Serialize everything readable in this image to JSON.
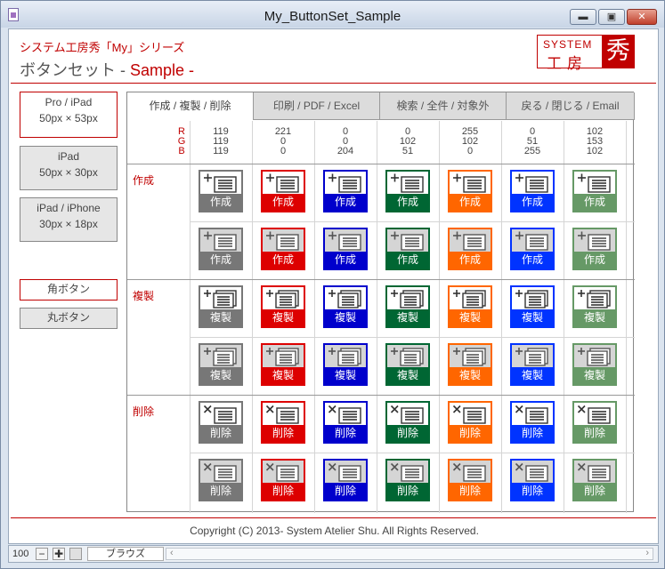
{
  "window": {
    "title": "My_ButtonSet_Sample",
    "min_glyph": "▬",
    "max_glyph": "▣",
    "close_glyph": "✕"
  },
  "header": {
    "subtitle": "システム工房秀「My」シリーズ",
    "heading_main": "ボタンセット - ",
    "heading_accent": "Sample -",
    "logo_top": "SYSTEM",
    "logo_bottom": "工房",
    "logo_mark": "秀"
  },
  "sidebar": {
    "sizes": [
      {
        "name": "Pro / iPad",
        "size": "50px × 53px",
        "selected": true
      },
      {
        "name": "iPad",
        "size": "50px × 30px",
        "selected": false
      },
      {
        "name": "iPad / iPhone",
        "size": "30px × 18px",
        "selected": false
      }
    ],
    "shapes": [
      {
        "label": "角ボタン",
        "selected": true
      },
      {
        "label": "丸ボタン",
        "selected": false
      }
    ]
  },
  "tabs": [
    {
      "label": "作成 / 複製 / 削除",
      "active": true
    },
    {
      "label": "印刷 / PDF / Excel",
      "active": false
    },
    {
      "label": "検索 / 全件 / 対象外",
      "active": false
    },
    {
      "label": "戻る / 閉じる / Email",
      "active": false
    }
  ],
  "rgb_labels": [
    "R",
    "G",
    "B"
  ],
  "colors": [
    {
      "r": "119",
      "g": "119",
      "b": "119",
      "hex": "#777777"
    },
    {
      "r": "221",
      "g": "0",
      "b": "0",
      "hex": "#dd0000"
    },
    {
      "r": "0",
      "g": "0",
      "b": "204",
      "hex": "#0000cc"
    },
    {
      "r": "0",
      "g": "102",
      "b": "51",
      "hex": "#006633"
    },
    {
      "r": "255",
      "g": "102",
      "b": "0",
      "hex": "#ff6600"
    },
    {
      "r": "0",
      "g": "51",
      "b": "255",
      "hex": "#0033ff"
    },
    {
      "r": "102",
      "g": "153",
      "b": "102",
      "hex": "#669966"
    }
  ],
  "rows": [
    {
      "label": "作成",
      "button_text": "作成",
      "icon": "create-icon"
    },
    {
      "label": "複製",
      "button_text": "複製",
      "icon": "copy-icon"
    },
    {
      "label": "削除",
      "button_text": "削除",
      "icon": "delete-icon"
    }
  ],
  "footer": {
    "copyright": "Copyright (C) 2013- System Atelier Shu. All Rights Reserved."
  },
  "statusbar": {
    "zoom": "100",
    "view": "ブラウズ",
    "minus_glyph": "−",
    "plus_glyph": "✚"
  }
}
